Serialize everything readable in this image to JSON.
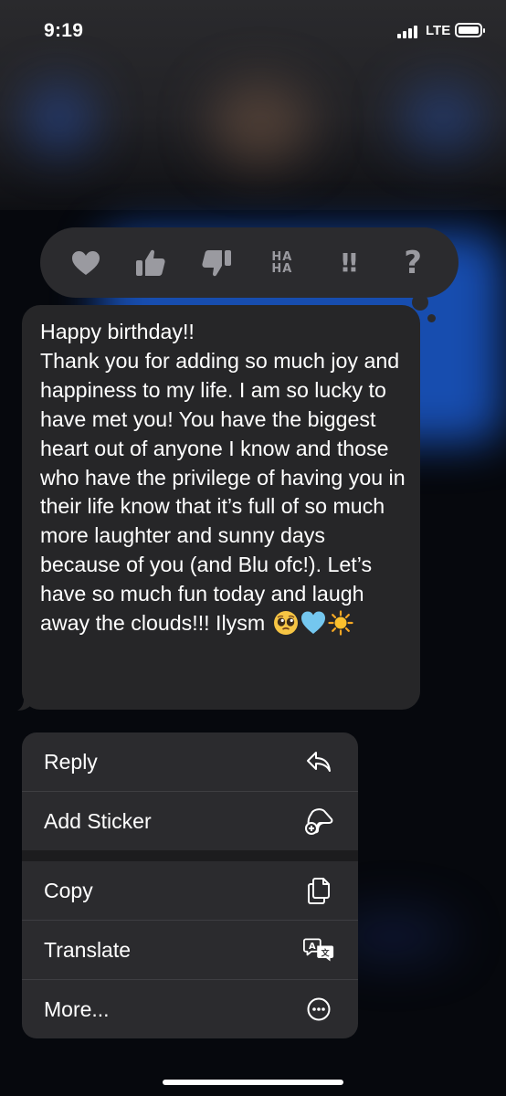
{
  "status_bar": {
    "time": "9:19",
    "network": "LTE"
  },
  "tapbacks": [
    {
      "name": "heart-icon"
    },
    {
      "name": "thumbs-up-icon"
    },
    {
      "name": "thumbs-down-icon"
    },
    {
      "name": "haha-icon",
      "label_top": "HA",
      "label_bottom": "HA"
    },
    {
      "name": "emphasize-icon",
      "label": "!!"
    },
    {
      "name": "question-icon",
      "label": "?"
    }
  ],
  "message": {
    "text": "Happy birthday!!\nThank you for adding so much joy and happiness to my life. I am so lucky to have met you! You have the biggest heart out of anyone I know and those who have the privilege of having you in their life know that it’s full of so much more laughter and sunny days because of you (and Blu ofc!). Let’s have so much fun today and laugh away the clouds!!! Ilysm",
    "emojis": [
      "pleading-face",
      "light-blue-heart",
      "sun"
    ]
  },
  "menu": {
    "items": [
      {
        "label": "Reply",
        "icon": "reply-icon"
      },
      {
        "label": "Add Sticker",
        "icon": "add-sticker-icon"
      },
      {
        "label": "Copy",
        "icon": "copy-icon"
      },
      {
        "label": "Translate",
        "icon": "translate-icon"
      },
      {
        "label": "More...",
        "icon": "more-icon"
      }
    ]
  },
  "colors": {
    "background": "#06080d",
    "bubble": "#262628",
    "menu": "#2b2b2e",
    "icon_gray": "#9a9aa0",
    "blue_blur": "#1e64e6"
  }
}
